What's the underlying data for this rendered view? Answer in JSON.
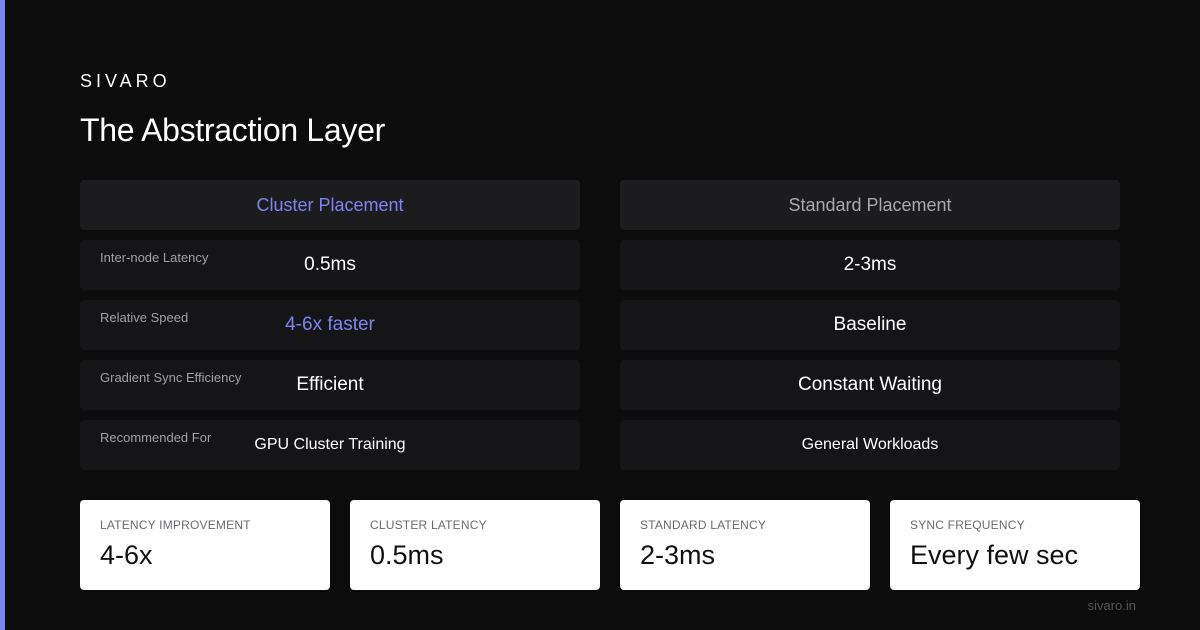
{
  "brand": "SIVARO",
  "title": "The Abstraction Layer",
  "accent_color": "#7b85ef",
  "comparison": {
    "cluster": {
      "header": "Cluster Placement",
      "rows": [
        {
          "label": "Inter-node Latency",
          "value": "0.5ms"
        },
        {
          "label": "Relative Speed",
          "value": "4-6x faster"
        },
        {
          "label": "Gradient Sync Efficiency",
          "value": "Efficient"
        },
        {
          "label": "Recommended For",
          "value": "GPU Cluster Training"
        }
      ]
    },
    "standard": {
      "header": "Standard Placement",
      "rows": [
        {
          "value": "2-3ms"
        },
        {
          "value": "Baseline"
        },
        {
          "value": "Constant Waiting"
        },
        {
          "value": "General Workloads"
        }
      ]
    }
  },
  "stats": [
    {
      "label": "LATENCY IMPROVEMENT",
      "value": "4-6x"
    },
    {
      "label": "CLUSTER LATENCY",
      "value": "0.5ms"
    },
    {
      "label": "STANDARD LATENCY",
      "value": "2-3ms"
    },
    {
      "label": "SYNC FREQUENCY",
      "value": "Every few sec"
    }
  ],
  "footer": "sivaro.in"
}
